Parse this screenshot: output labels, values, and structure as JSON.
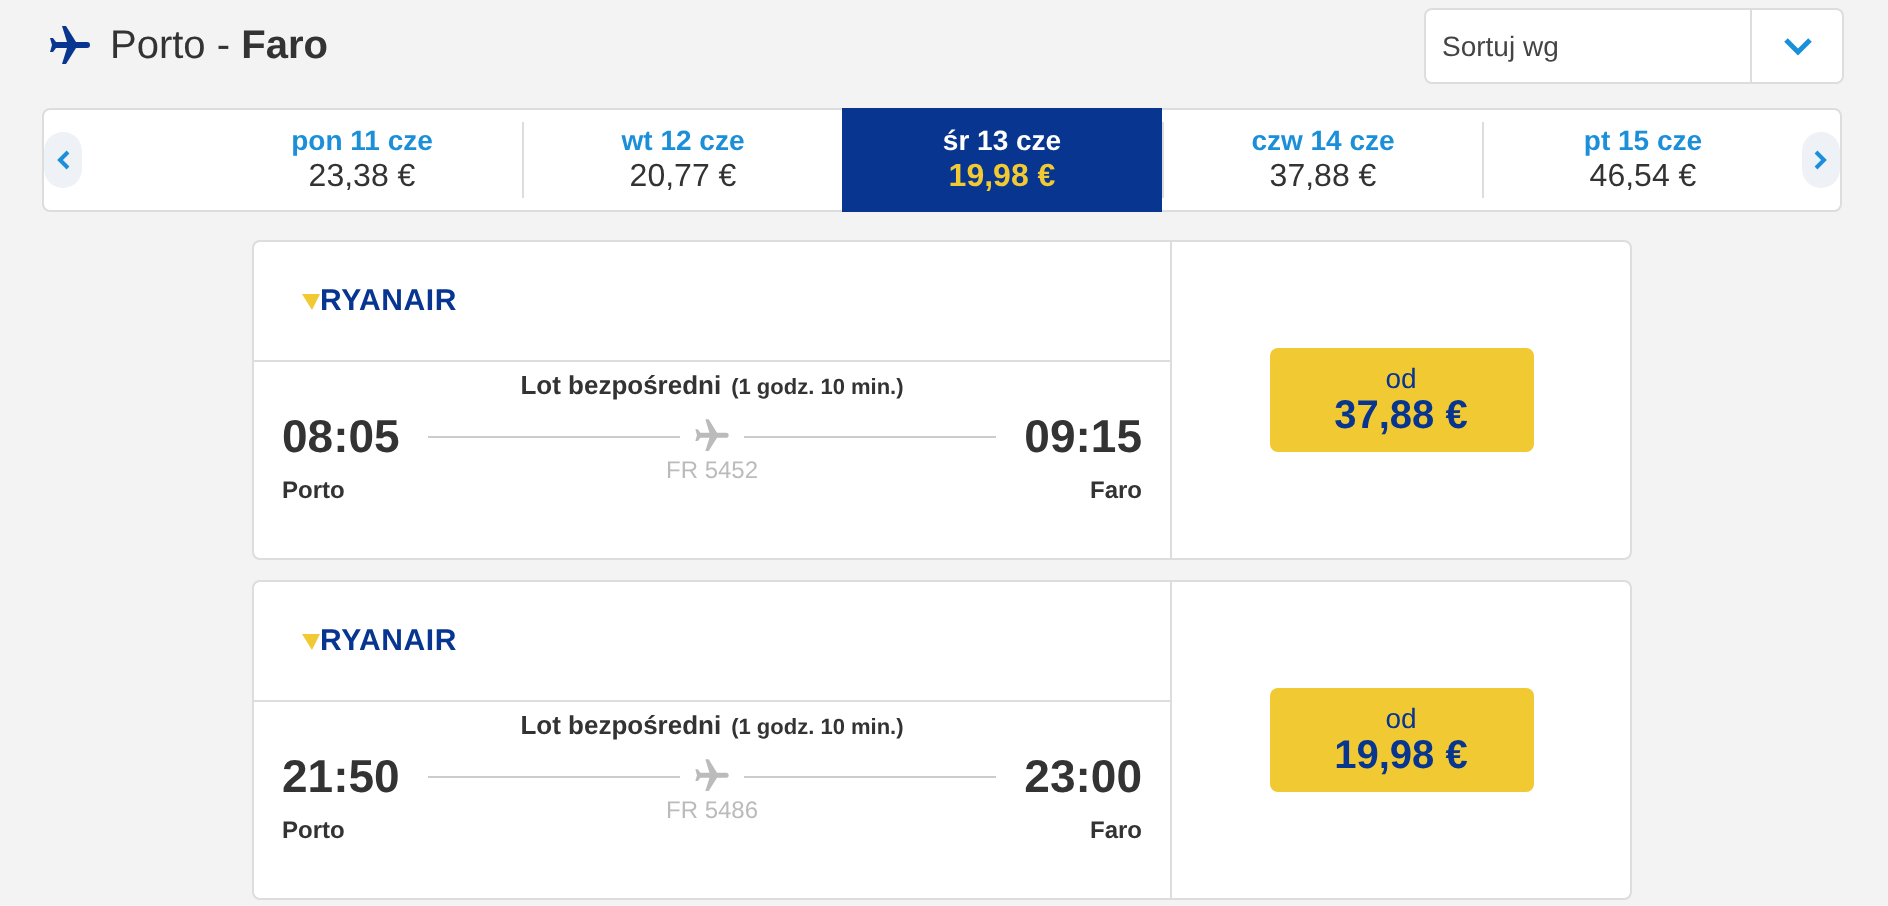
{
  "route": {
    "from": "Porto",
    "separator": "-",
    "to": "Faro"
  },
  "sort": {
    "placeholder": "Sortuj wg"
  },
  "dates": [
    {
      "day": "pon 11 cze",
      "price": "23,38 €",
      "selected": false
    },
    {
      "day": "wt 12 cze",
      "price": "20,77 €",
      "selected": false
    },
    {
      "day": "śr 13 cze",
      "price": "19,98 €",
      "selected": true
    },
    {
      "day": "czw 14 cze",
      "price": "37,88 €",
      "selected": false
    },
    {
      "day": "pt 15 cze",
      "price": "46,54 €",
      "selected": false
    }
  ],
  "flights": [
    {
      "airline": "RYANAIR",
      "type": "Lot bezpośredni",
      "duration": "(1 godz. 10 min.)",
      "depart_time": "08:05",
      "depart_city": "Porto",
      "arrive_time": "09:15",
      "arrive_city": "Faro",
      "flight_no": "FR 5452",
      "price_label": "od",
      "price": "37,88 €"
    },
    {
      "airline": "RYANAIR",
      "type": "Lot bezpośredni",
      "duration": "(1 godz. 10 min.)",
      "depart_time": "21:50",
      "depart_city": "Porto",
      "arrive_time": "23:00",
      "arrive_city": "Faro",
      "flight_no": "FR 5486",
      "price_label": "od",
      "price": "19,98 €"
    }
  ]
}
